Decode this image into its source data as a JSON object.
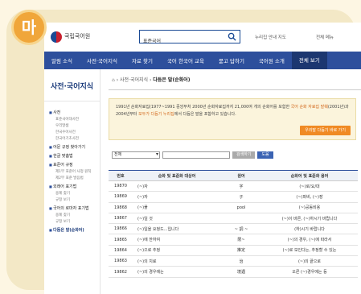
{
  "badge": "마",
  "header": {
    "logo": "국립국어원",
    "search_value": "표준국어",
    "util_links": [
      "누리집 안내 지도",
      "전체 메뉴"
    ]
  },
  "nav": {
    "items": [
      "알림 소식",
      "사전·국어지식",
      "자료 찾기",
      "국어 한국어 교육",
      "묻고 답하기",
      "국어원 소개",
      "전체 보기"
    ]
  },
  "sidebar": {
    "title": "사전·국어지식",
    "groups": [
      {
        "label": "사전",
        "subs": [
          "표준국어대사전",
          "우리말샘",
          "한국수어사전",
          "한국어기초사전"
        ]
      },
      {
        "label": "어문 규정 찾아가기",
        "subs": []
      },
      {
        "label": "한글 맞춤법",
        "subs": []
      },
      {
        "label": "표준어 규정",
        "subs": [
          "제1부 표준어 사정 원칙",
          "제2부 표준 발음법"
        ]
      },
      {
        "label": "외래어 표기법",
        "subs": [
          "용례 찾기",
          "규정 보기"
        ]
      },
      {
        "label": "국어의 로마자 표기법",
        "subs": [
          "용례 찾기",
          "규정 보기"
        ]
      },
      {
        "label": "다듬은 말(순화어)",
        "subs": []
      }
    ]
  },
  "main": {
    "breadcrumb": [
      "사전·국어지식",
      "다듬은 말(순화어)"
    ],
    "notice_text_1": "1991년 순화자료집(1977~1991 중앙부처 2000년 순화자료집까지 21,000여 개의 순화어를 포함한",
    "notice_hl_1": "국어 순화 자료집 발췌",
    "notice_text_2": "(2001년)과 2004년부터",
    "notice_hl_2": "모두가 다듬기 누리집",
    "notice_text_3": "에서 다듬은 말을 포함하고 있습니다.",
    "notice_button": "우리말 다듬기 바로 가기",
    "filter_select": "전체",
    "filter_search": "검색하기",
    "filter_help": "도움",
    "table": {
      "headers": [
        "번호",
        "순화 및 표준화 대상어",
        "원어",
        "순화어 및 표준화 용어"
      ],
      "rows": [
        [
          "19870",
          "(~)자",
          "字",
          "(~)로/요/대"
        ],
        [
          "19869",
          "(~)자",
          "子",
          "(~)파비, (~)장"
        ],
        [
          "19868",
          "(~)풀",
          "pool",
          "(~)공동비용"
        ],
        [
          "19867",
          "(~)일 것",
          "",
          "(~)이 바른, (~)하시기 바랍니다"
        ],
        [
          "19866",
          "(~)일을 요청드...입니다",
          "~ 調 ~",
          "(하)시기 바랍니다"
        ],
        [
          "19865",
          "(~)에 한하여",
          "限~",
          "(~)의 경우, (~)에 따라서"
        ],
        [
          "19864",
          "(~)으로 추정",
          "推定",
          "(~)로 보인다는, 추정할 수 있는"
        ],
        [
          "19863",
          "(~)의 치료",
          "治",
          "(~)의 끝으로"
        ],
        [
          "19862",
          "(~)의 경우에는",
          "境遇",
          "오른 (~)경우에는 등"
        ]
      ]
    }
  },
  "colors": {
    "nav": "#2d4f9c",
    "badge": "#f0a63a",
    "notice_button": "#f08a24"
  }
}
